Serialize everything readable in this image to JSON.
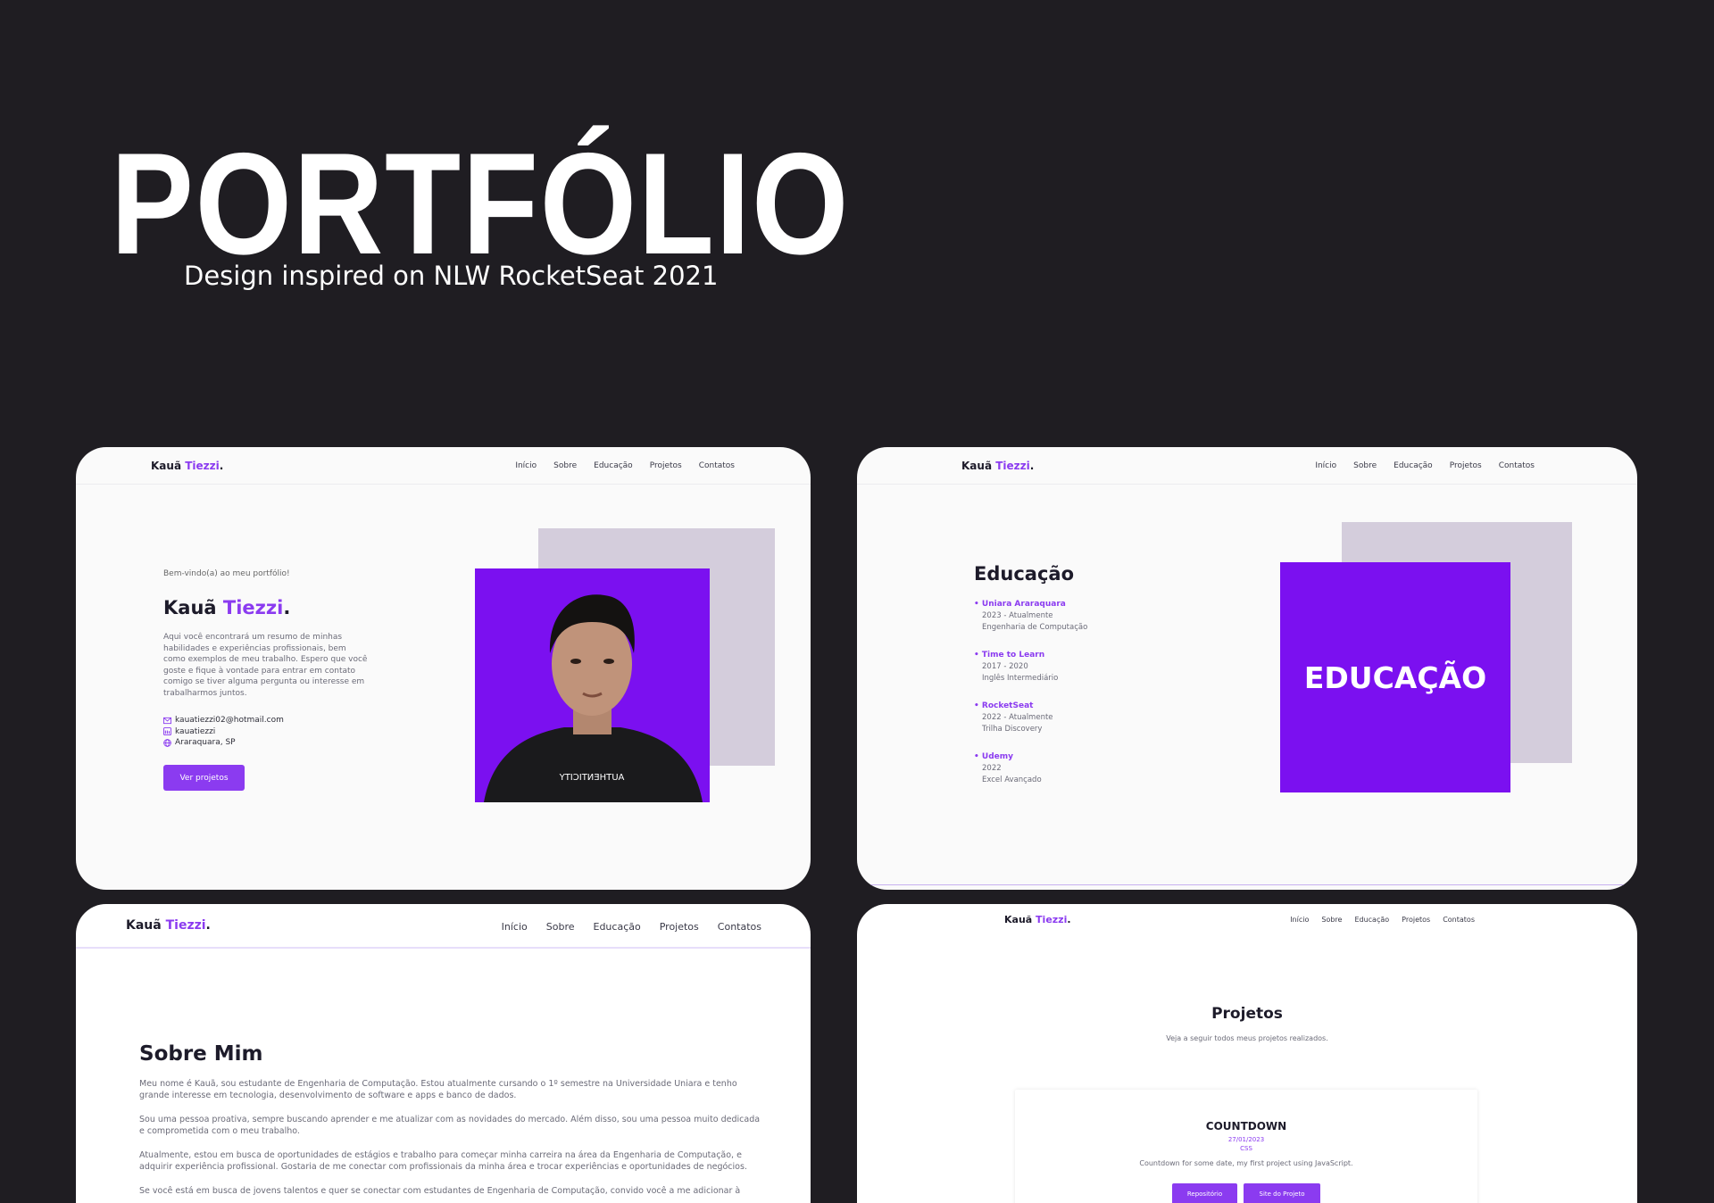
{
  "hero": {
    "title": "PORTFÓLIO",
    "subtitle": "Design inspired on NLW RocketSeat 2021"
  },
  "brand": {
    "first": "Kauã",
    "last": "Tiezzi",
    "dot": "."
  },
  "nav": [
    "Início",
    "Sobre",
    "Educação",
    "Projetos",
    "Contatos"
  ],
  "home": {
    "welcome": "Bem-vindo(a) ao meu portfólio!",
    "name_first": "Kauã",
    "name_last": "Tiezzi",
    "name_dot": ".",
    "intro": "Aqui você encontrará um resumo de minhas habilidades e experiências profissionais, bem como exemplos de meu trabalho. Espero que você goste e fique à vontade para entrar em contato comigo se tiver alguma pergunta ou interesse em trabalharmos juntos.",
    "contacts": [
      {
        "icon": "mail-icon",
        "text": "kauatiezzi02@hotmail.com"
      },
      {
        "icon": "linkedin-icon",
        "text": "kauatiezzi"
      },
      {
        "icon": "globe-icon",
        "text": "Araraquara, SP"
      }
    ],
    "button": "Ver projetos",
    "shirt_text": "AUTHENTICITY"
  },
  "education": {
    "title": "Educação",
    "items": [
      {
        "name": "Uniara Araraquara",
        "period": "2023 - Atualmente",
        "course": "Engenharia de Computação"
      },
      {
        "name": "Time to Learn",
        "period": "2017 - 2020",
        "course": "Inglês Intermediário"
      },
      {
        "name": "RocketSeat",
        "period": "2022 - Atualmente",
        "course": "Trilha Discovery"
      },
      {
        "name": "Udemy",
        "period": "2022",
        "course": "Excel Avançado"
      }
    ],
    "banner": "EDUCAÇÃO"
  },
  "about": {
    "title": "Sobre Mim",
    "paragraphs": [
      "Meu nome é Kauã, sou estudante de Engenharia de Computação. Estou atualmente cursando o 1º semestre na Universidade Uniara e tenho grande interesse em tecnologia, desenvolvimento de software e apps e banco de dados.",
      "Sou uma pessoa proativa, sempre buscando aprender e me atualizar com as novidades do mercado. Além disso, sou uma pessoa muito dedicada e comprometida com o meu trabalho.",
      "Atualmente, estou em busca de oportunidades de estágios e trabalho para começar minha carreira na área da Engenharia de Computação, e adquirir experiência profissional. Gostaria de me conectar com profissionais da minha área e trocar experiências e oportunidades de negócios.",
      "Se você está em busca de jovens talentos e quer se conectar com estudantes de Engenharia de Computação, convido você a me adicionar à"
    ]
  },
  "projects": {
    "title": "Projetos",
    "subtitle": "Veja a seguir todos meus projetos realizados.",
    "card": {
      "title": "COUNTDOWN",
      "date": "27/01/2023",
      "tag": "CSS",
      "description": "Countdown for some date, my first project using JavaScript.",
      "repo_button": "Repositório",
      "site_button": "Site do Projeto"
    }
  },
  "colors": {
    "accent": "#8b3bf0",
    "banner": "#7b10f0",
    "background": "#1f1d22",
    "shade": "#d4cddc"
  }
}
